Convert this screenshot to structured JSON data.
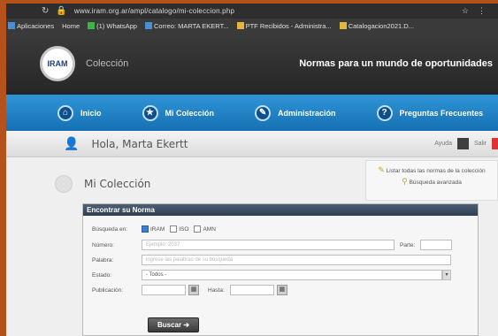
{
  "browser": {
    "url": "www.iram.org.ar/ampl/catalogo/mi-coleccion.php",
    "bookmarks": [
      {
        "label": "Aplicaciones",
        "icon": "apps-icon"
      },
      {
        "label": "Home",
        "icon": "home-icon"
      },
      {
        "label": "(1) WhatsApp",
        "icon": "whatsapp-icon"
      },
      {
        "label": "Correo: MARTA EKERT...",
        "icon": "mail-icon"
      },
      {
        "label": "PTF Recibidos - Administra...",
        "icon": "folder-icon"
      },
      {
        "label": "Catalogacion2021.D...",
        "icon": "doc-icon"
      }
    ]
  },
  "header": {
    "logo_text": "IRAM",
    "site_title": "Colección",
    "slogan": "Normas para un mundo de oportunidades"
  },
  "nav": {
    "items": [
      {
        "label": "Inicio",
        "icon": "home-icon"
      },
      {
        "label": "Mi Colección",
        "icon": "collection-icon"
      },
      {
        "label": "Administración",
        "icon": "admin-icon"
      },
      {
        "label": "Preguntas Frecuentes",
        "icon": "help-icon"
      }
    ]
  },
  "greeting": {
    "text": "Hola, Marta Ekertt",
    "right_label_1": "Ayuda",
    "right_label_2": "Salir"
  },
  "collection": {
    "title": "Mi Colección",
    "side_link_1": "Listar todas las normas de la colección",
    "side_link_2": "Búsqueda avanzada"
  },
  "search": {
    "panel_title": "Encontrar su Norma",
    "search_in_label": "Búsqueda en:",
    "options": [
      {
        "label": "IRAM",
        "checked": true
      },
      {
        "label": "ISO",
        "checked": false
      },
      {
        "label": "AMN",
        "checked": false
      }
    ],
    "number_label": "Número:",
    "number_placeholder": "Ejemplo: 2037",
    "part_label": "Parte:",
    "keyword_label": "Palabra:",
    "keyword_placeholder": "ingrese las palabras de su búsqueda",
    "status_label": "Estado:",
    "status_value": "- Todos -",
    "pub_label": "Publicación:",
    "to_label": "Hasta:",
    "search_button": "Buscar"
  }
}
